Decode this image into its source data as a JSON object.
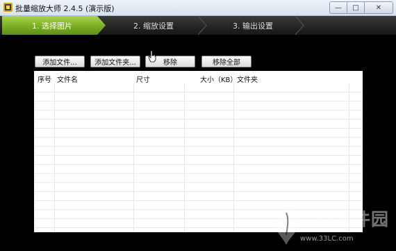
{
  "window": {
    "title": "批量缩放大师 2.4.5 (演示版)"
  },
  "steps": [
    {
      "label": "1. 选择图片",
      "active": true
    },
    {
      "label": "2. 缩放设置",
      "active": false
    },
    {
      "label": "3. 输出设置",
      "active": false
    }
  ],
  "toolbar": {
    "add_file": "添加文件...",
    "add_folder": "添加文件夹...",
    "remove": "移除",
    "remove_all": "移除全部"
  },
  "table": {
    "columns": [
      "序号",
      "文件名",
      "尺寸",
      "大小（KB）",
      "文件夹"
    ],
    "rows": []
  },
  "watermark": {
    "text": "绿茶软件园",
    "url": "www.33LC.com"
  },
  "colors": {
    "step_active": "#7fb226",
    "step_inactive": "#262626",
    "background": "#000000"
  }
}
